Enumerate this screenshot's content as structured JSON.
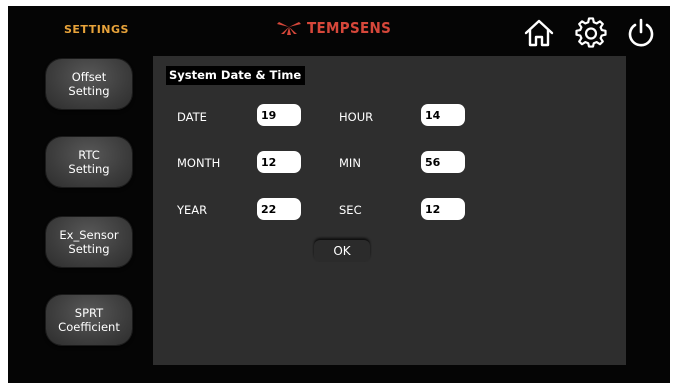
{
  "header": {
    "title": "SETTINGS",
    "brand": "TEMPSENS",
    "icons": [
      "home-icon",
      "gear-icon",
      "power-icon"
    ],
    "colors": {
      "title": "#e8a33a",
      "brand": "#d6473a",
      "background": "#050505",
      "panel": "#2e2e2e"
    }
  },
  "sidebar": {
    "items": [
      {
        "label": "Offset\nSetting"
      },
      {
        "label": "RTC\nSetting"
      },
      {
        "label": "Ex_Sensor\nSetting"
      },
      {
        "label": "SPRT\nCoefficient"
      }
    ]
  },
  "panel": {
    "title": "System Date & Time",
    "fields": {
      "date": {
        "label": "DATE",
        "value": "19"
      },
      "month": {
        "label": "MONTH",
        "value": "12"
      },
      "year": {
        "label": "YEAR",
        "value": "22"
      },
      "hour": {
        "label": "HOUR",
        "value": "14"
      },
      "min": {
        "label": "MIN",
        "value": "56"
      },
      "sec": {
        "label": "SEC",
        "value": "12"
      }
    },
    "ok_label": "OK"
  }
}
